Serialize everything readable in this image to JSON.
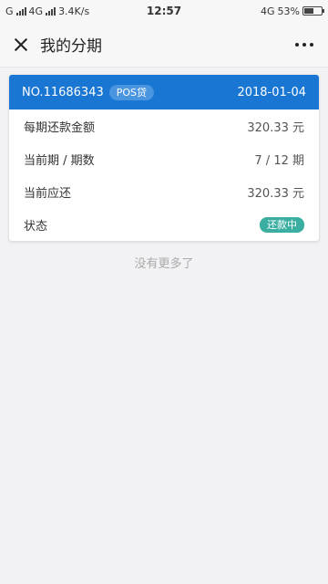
{
  "status_bar": {
    "left_carrier": "G",
    "left_network": "4G",
    "speed": "3.4K/s",
    "time": "12:57",
    "right_network": "4G",
    "battery": "53%",
    "battery_level": 0.53
  },
  "nav": {
    "title": "我的分期"
  },
  "card": {
    "number": "NO.11686343",
    "tag": "POS贷",
    "date": "2018-01-04",
    "rows": [
      {
        "label": "每期还款金额",
        "value": "320.33 元"
      },
      {
        "label": "当前期 / 期数",
        "value": "7 / 12 期"
      },
      {
        "label": "当前应还",
        "value": "320.33 元"
      }
    ],
    "status_label": "状态",
    "status_value": "还款中"
  },
  "footer": {
    "no_more": "没有更多了"
  },
  "colors": {
    "header_blue": "#1976d2",
    "status_green": "#3aaea0"
  }
}
